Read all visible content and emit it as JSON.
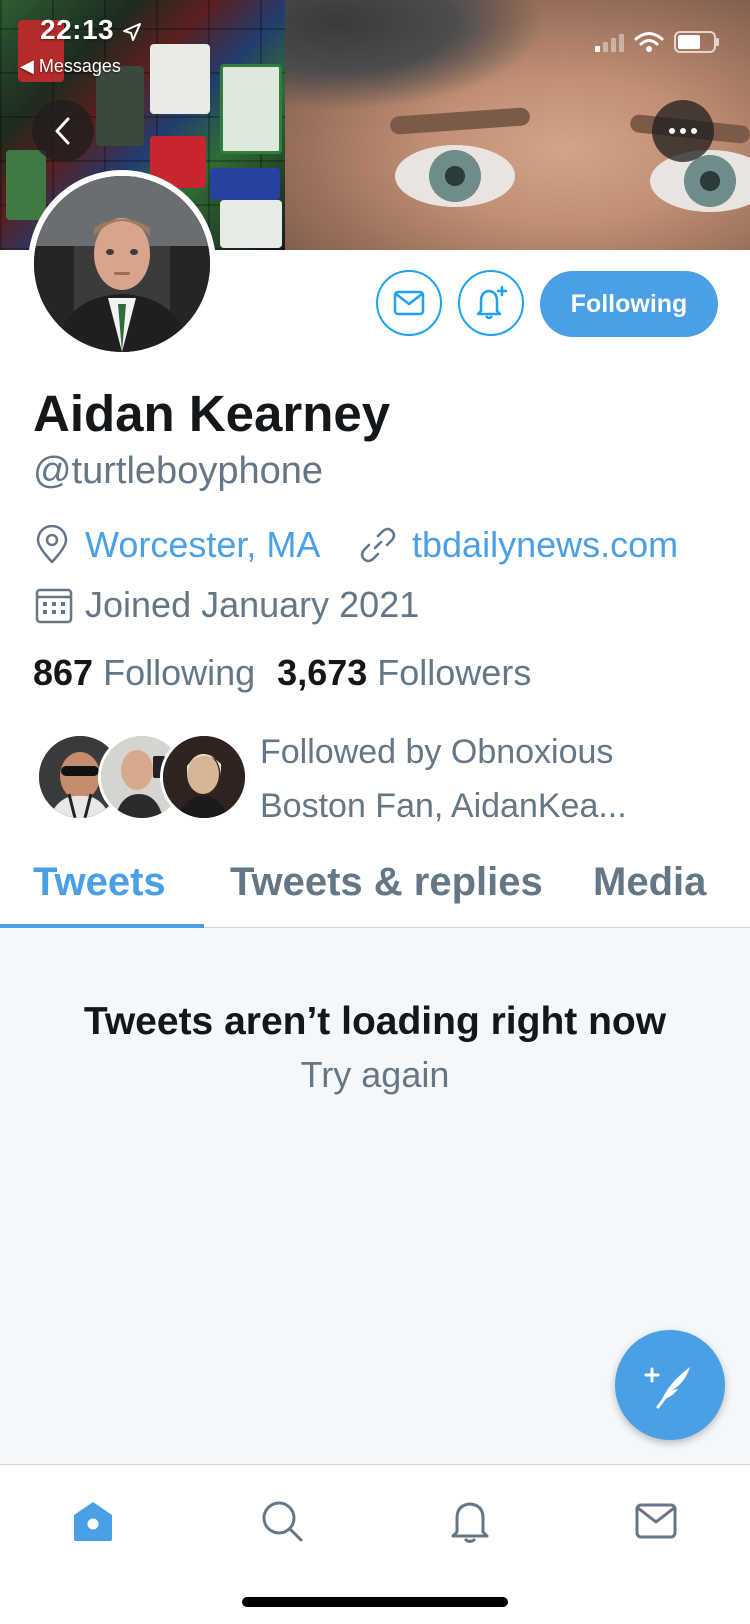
{
  "status_bar": {
    "time": "22:13",
    "back_app": "◀ Messages"
  },
  "profile": {
    "name": "Aidan Kearney",
    "handle": "@turtleboyphone",
    "location": "Worcester, MA",
    "website": "tbdailynews.com",
    "joined": "Joined January 2021",
    "following_count": "867",
    "following_label": "Following",
    "followers_count": "3,673",
    "followers_label": "Followers",
    "followed_by_line1": "Followed by Obnoxious",
    "followed_by_line2": "Boston Fan, AidanKea..."
  },
  "actions": {
    "following_button": "Following"
  },
  "tabs": [
    {
      "label": "Tweets",
      "active": true
    },
    {
      "label": "Tweets & replies",
      "active": false
    },
    {
      "label": "Media",
      "active": false
    }
  ],
  "content": {
    "error_title": "Tweets aren’t loading right now",
    "retry_label": "Try again"
  },
  "bottom_nav": [
    {
      "icon": "home-icon",
      "active": true
    },
    {
      "icon": "search-icon",
      "active": false
    },
    {
      "icon": "bell-icon",
      "active": false
    },
    {
      "icon": "mail-icon",
      "active": false
    }
  ],
  "colors": {
    "accent": "#4a9fe5",
    "secondary_text": "#657786",
    "primary_text": "#14171a",
    "content_bg": "#f5f8fa"
  }
}
